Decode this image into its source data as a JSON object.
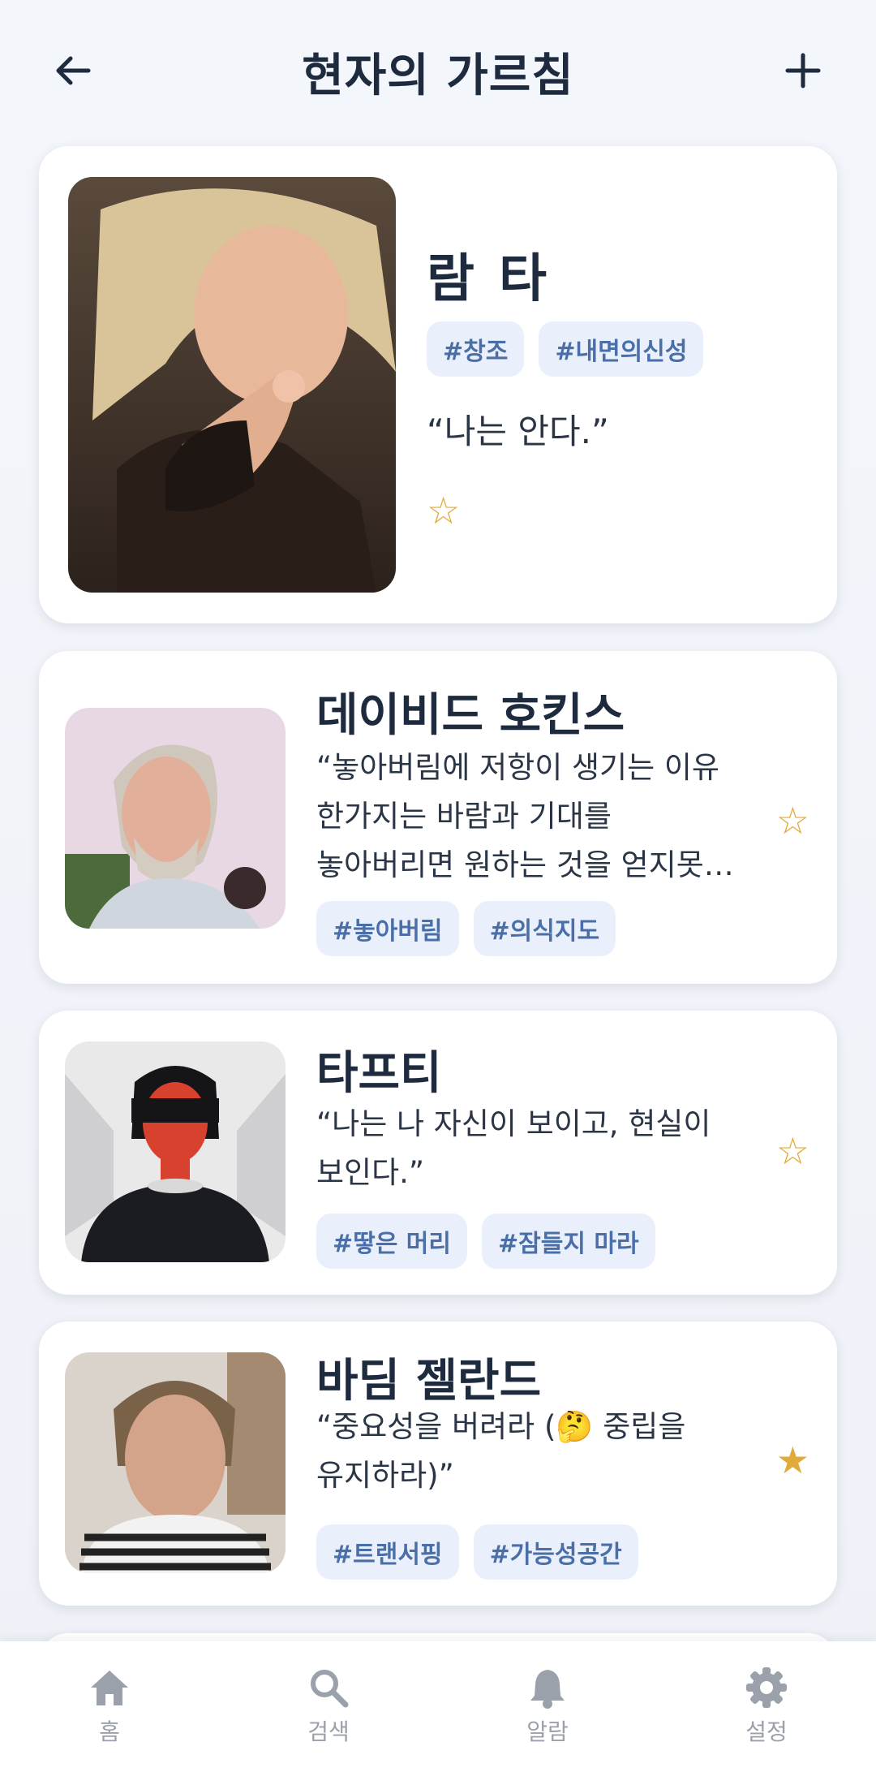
{
  "header": {
    "title": "현자의 가르침",
    "back_icon": "arrow-left-icon",
    "add_icon": "plus-icon"
  },
  "colors": {
    "accent_star": "#e2a93b",
    "tag_bg": "#eaf0fb",
    "tag_text": "#4a6fa8",
    "title_text": "#1e2a3e",
    "nav_inactive": "#9aa1ab"
  },
  "teachers": [
    {
      "name": "람 타",
      "tags": [
        "#창조",
        "#내면의신성"
      ],
      "quote": "“나는 안다.”",
      "favorite": false,
      "star_symbol": "☆"
    },
    {
      "name": "데이비드 호킨스",
      "tags": [
        "#놓아버림",
        "#의식지도"
      ],
      "quote": "“놓아버림에 저항이 생기는 이유\n한가지는 바람과 기대를\n놓아버리면 원하는 것을 얻지못…",
      "favorite": false,
      "star_symbol": "☆"
    },
    {
      "name": "타프티",
      "tags": [
        "#땋은 머리",
        "#잠들지 마라"
      ],
      "quote": "“나는 나 자신이 보이고, 현실이\n보인다.”",
      "favorite": false,
      "star_symbol": "☆"
    },
    {
      "name": "바딤 젤란드",
      "tags": [
        "#트랜서핑",
        "#가능성공간"
      ],
      "quote": "“중요성을 버려라 (🤔 중립을\n유지하라)”",
      "favorite": true,
      "star_symbol": "★"
    }
  ],
  "bottom_nav": [
    {
      "label": "홈",
      "icon": "home-icon"
    },
    {
      "label": "검색",
      "icon": "search-icon"
    },
    {
      "label": "알람",
      "icon": "bell-icon"
    },
    {
      "label": "설정",
      "icon": "gear-icon"
    }
  ]
}
